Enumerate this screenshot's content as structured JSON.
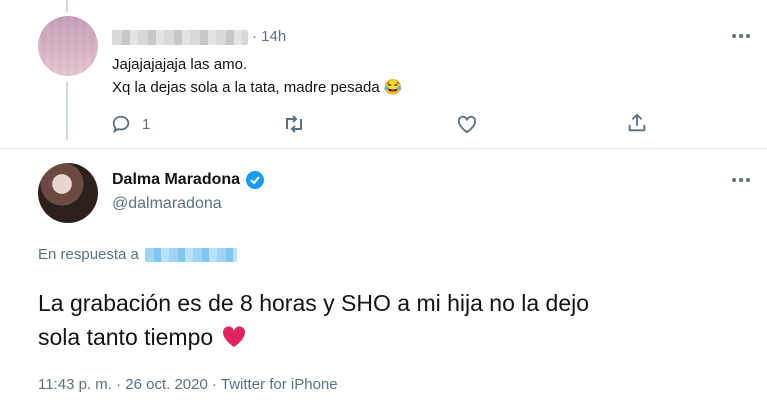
{
  "reply_tweet": {
    "handle_time": "· 14h",
    "text_line1": "Jajajajajaja las amo.",
    "text_line2": "Xq la dejas sola a la tata, madre pesada",
    "emoji": "😂",
    "reply_count": "1"
  },
  "main_tweet": {
    "display_name": "Dalma Maradona",
    "username": "@dalmaradona",
    "replying_to_label": "En respuesta a",
    "body_line1": "La grabación es de 8 horas y SHO a mi hija no la dejo",
    "body_line2": "sola tanto tiempo",
    "heart": "❤️",
    "meta": "11:43 p. m. · 26 oct. 2020 · Twitter for iPhone"
  },
  "colors": {
    "verified": "#1d9bf0",
    "heart": "#e0245e",
    "muted": "#5b7083"
  }
}
